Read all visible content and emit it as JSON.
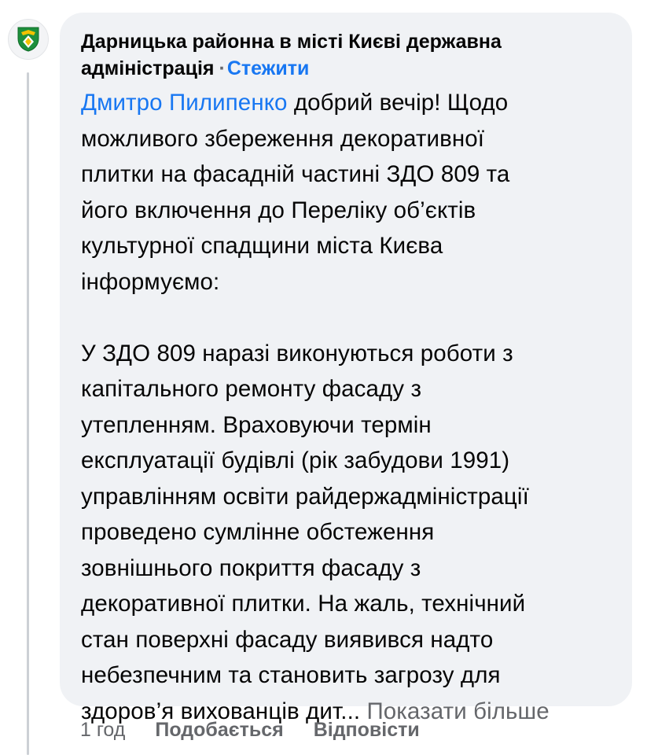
{
  "comment": {
    "author": "Дарницька районна в місті Києві державна адміністрація",
    "separator": "·",
    "follow_label": "Стежити",
    "mention": "Дмитро Пилипенко",
    "body_text": " добрий вечір! Щодо\nможливого збереження декоративної\nплитки на фасадній частині ЗДО 809 та\nйого включення до Переліку об’єктів\nкультурної спадщини міста Києва\nінформуємо:\n\nУ ЗДО 809 наразі виконуються роботи з\nкапітального ремонту фасаду з\nутепленням. Враховуючи термін\nексплуатації будівлі (рік забудови 1991)\nуправлінням освіти райдержадміністрації\nпроведено сумлінне обстеження\nзовнішнього покриття фасаду з\nдекоративної плитки. На жаль, технічний\nстан поверхні фасаду виявився надто\nнебезпечним та становить загрозу для\nздоров’я вихованців дит...",
    "see_more_label": "Показати більше",
    "time": "1 год",
    "like_label": "Подобається",
    "reply_label": "Відповісти"
  },
  "colors": {
    "link": "#1877f2",
    "bubble_bg": "#f0f2f5",
    "secondary_text": "#65676b",
    "coat_of_arms_green": "#1d8f3c",
    "coat_of_arms_gold": "#f2c200"
  },
  "icons": {
    "avatar": "district-coat-of-arms-icon"
  }
}
